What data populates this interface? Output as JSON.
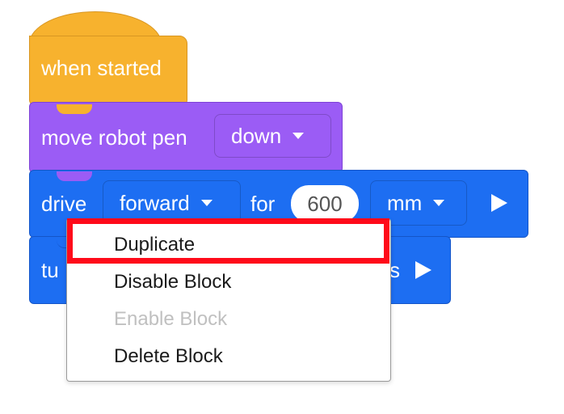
{
  "blocks": {
    "hat": {
      "label": "when started",
      "color": "#F7B22E"
    },
    "pen": {
      "label": "move robot pen",
      "dropdown": "down",
      "color": "#9B5CF5"
    },
    "drive": {
      "label": "drive",
      "direction": "forward",
      "for_label": "for",
      "distance": "600",
      "unit": "mm",
      "color": "#1D6EF2"
    },
    "turn": {
      "label_start": "tu",
      "label_end": "s"
    }
  },
  "context_menu": {
    "items": [
      {
        "label": "Duplicate",
        "enabled": true,
        "highlighted": true
      },
      {
        "label": "Disable Block",
        "enabled": true
      },
      {
        "label": "Enable Block",
        "enabled": false
      },
      {
        "label": "Delete Block",
        "enabled": true
      }
    ],
    "highlight_color": "#FF0A1A"
  }
}
